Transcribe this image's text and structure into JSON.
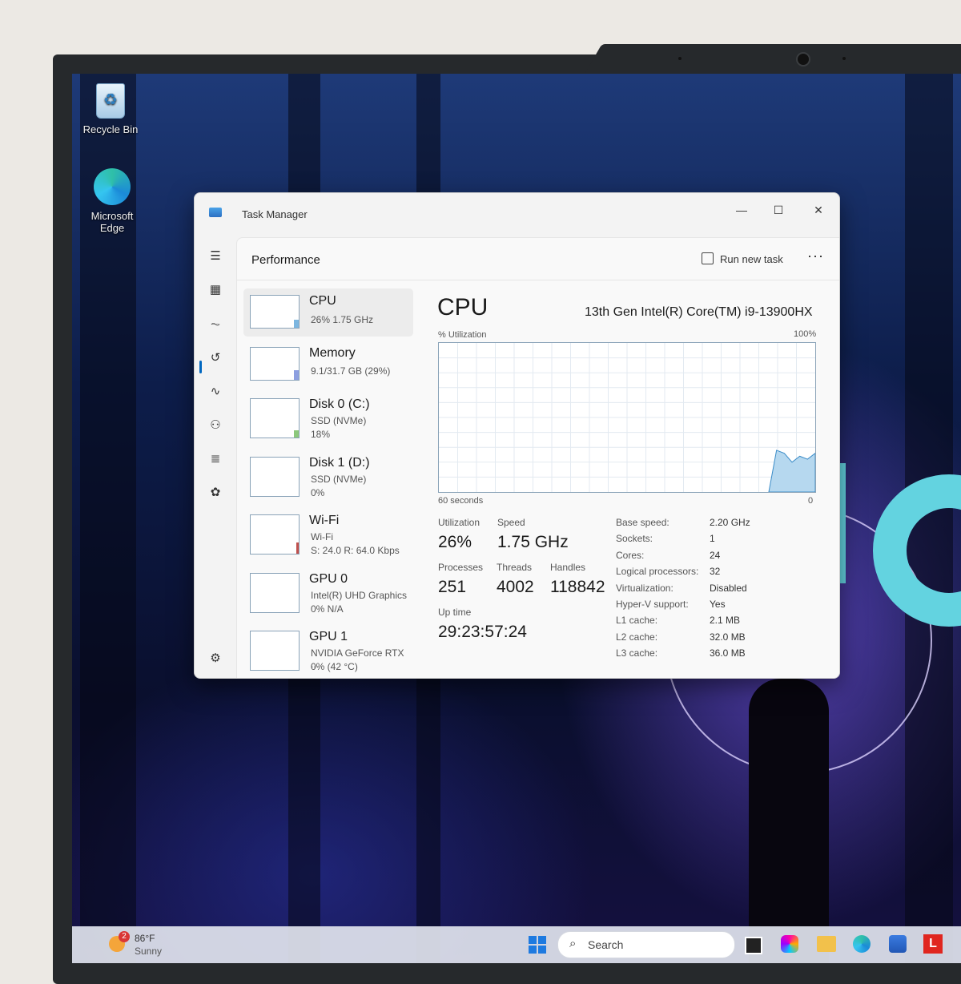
{
  "desktop": {
    "icons": [
      {
        "label": "Recycle Bin"
      },
      {
        "label": "Microsoft Edge"
      }
    ]
  },
  "taskbar": {
    "weather_temp": "86°F",
    "weather_cond": "Sunny",
    "weather_badge": "2",
    "search_label": "Search"
  },
  "window": {
    "title": "Task Manager",
    "controls": {
      "minimize": "—",
      "maximize": "☐",
      "close": "✕"
    }
  },
  "header": {
    "page_title": "Performance",
    "run_new_task": "Run new task",
    "more": "···"
  },
  "resources": [
    {
      "name": "CPU",
      "line1": "26%  1.75 GHz",
      "line2": "",
      "level": 0.26,
      "color": "#7cb6e0"
    },
    {
      "name": "Memory",
      "line1": "9.1/31.7 GB (29%)",
      "line2": "",
      "level": 0.29,
      "color": "#8d9fe0"
    },
    {
      "name": "Disk 0 (C:)",
      "line1": "SSD (NVMe)",
      "line2": "18%",
      "level": 0.18,
      "color": "#8cc87c"
    },
    {
      "name": "Disk 1 (D:)",
      "line1": "SSD (NVMe)",
      "line2": "0%",
      "level": 0,
      "color": "#8cc87c"
    },
    {
      "name": "Wi-Fi",
      "line1": "Wi-Fi",
      "line2": "S: 24.0  R: 64.0 Kbps",
      "level": 0.3,
      "color": "#c0504d"
    },
    {
      "name": "GPU 0",
      "line1": "Intel(R) UHD Graphics",
      "line2": "0%  N/A",
      "level": 0,
      "color": "#7cb6e0"
    },
    {
      "name": "GPU 1",
      "line1": "NVIDIA GeForce RTX ...",
      "line2": "0%  (42 °C)",
      "level": 0,
      "color": "#7cb6e0"
    }
  ],
  "cpu": {
    "title": "CPU",
    "model": "13th Gen Intel(R) Core(TM) i9-13900HX",
    "graph_label": "% Utilization",
    "graph_max": "100%",
    "graph_time": "60 seconds",
    "graph_min": "0",
    "utilization_label": "Utilization",
    "utilization": "26%",
    "speed_label": "Speed",
    "speed": "1.75 GHz",
    "processes_label": "Processes",
    "processes": "251",
    "threads_label": "Threads",
    "threads": "4002",
    "handles_label": "Handles",
    "handles": "118842",
    "uptime_label": "Up time",
    "uptime": "29:23:57:24",
    "specs": [
      {
        "k": "Base speed:",
        "v": "2.20 GHz"
      },
      {
        "k": "Sockets:",
        "v": "1"
      },
      {
        "k": "Cores:",
        "v": "24"
      },
      {
        "k": "Logical processors:",
        "v": "32"
      },
      {
        "k": "Virtualization:",
        "v": "Disabled"
      },
      {
        "k": "Hyper-V support:",
        "v": "Yes"
      },
      {
        "k": "L1 cache:",
        "v": "2.1 MB"
      },
      {
        "k": "L2 cache:",
        "v": "32.0 MB"
      },
      {
        "k": "L3 cache:",
        "v": "36.0 MB"
      }
    ],
    "history_percent": [
      0,
      28,
      26,
      20,
      24,
      22,
      26
    ]
  }
}
